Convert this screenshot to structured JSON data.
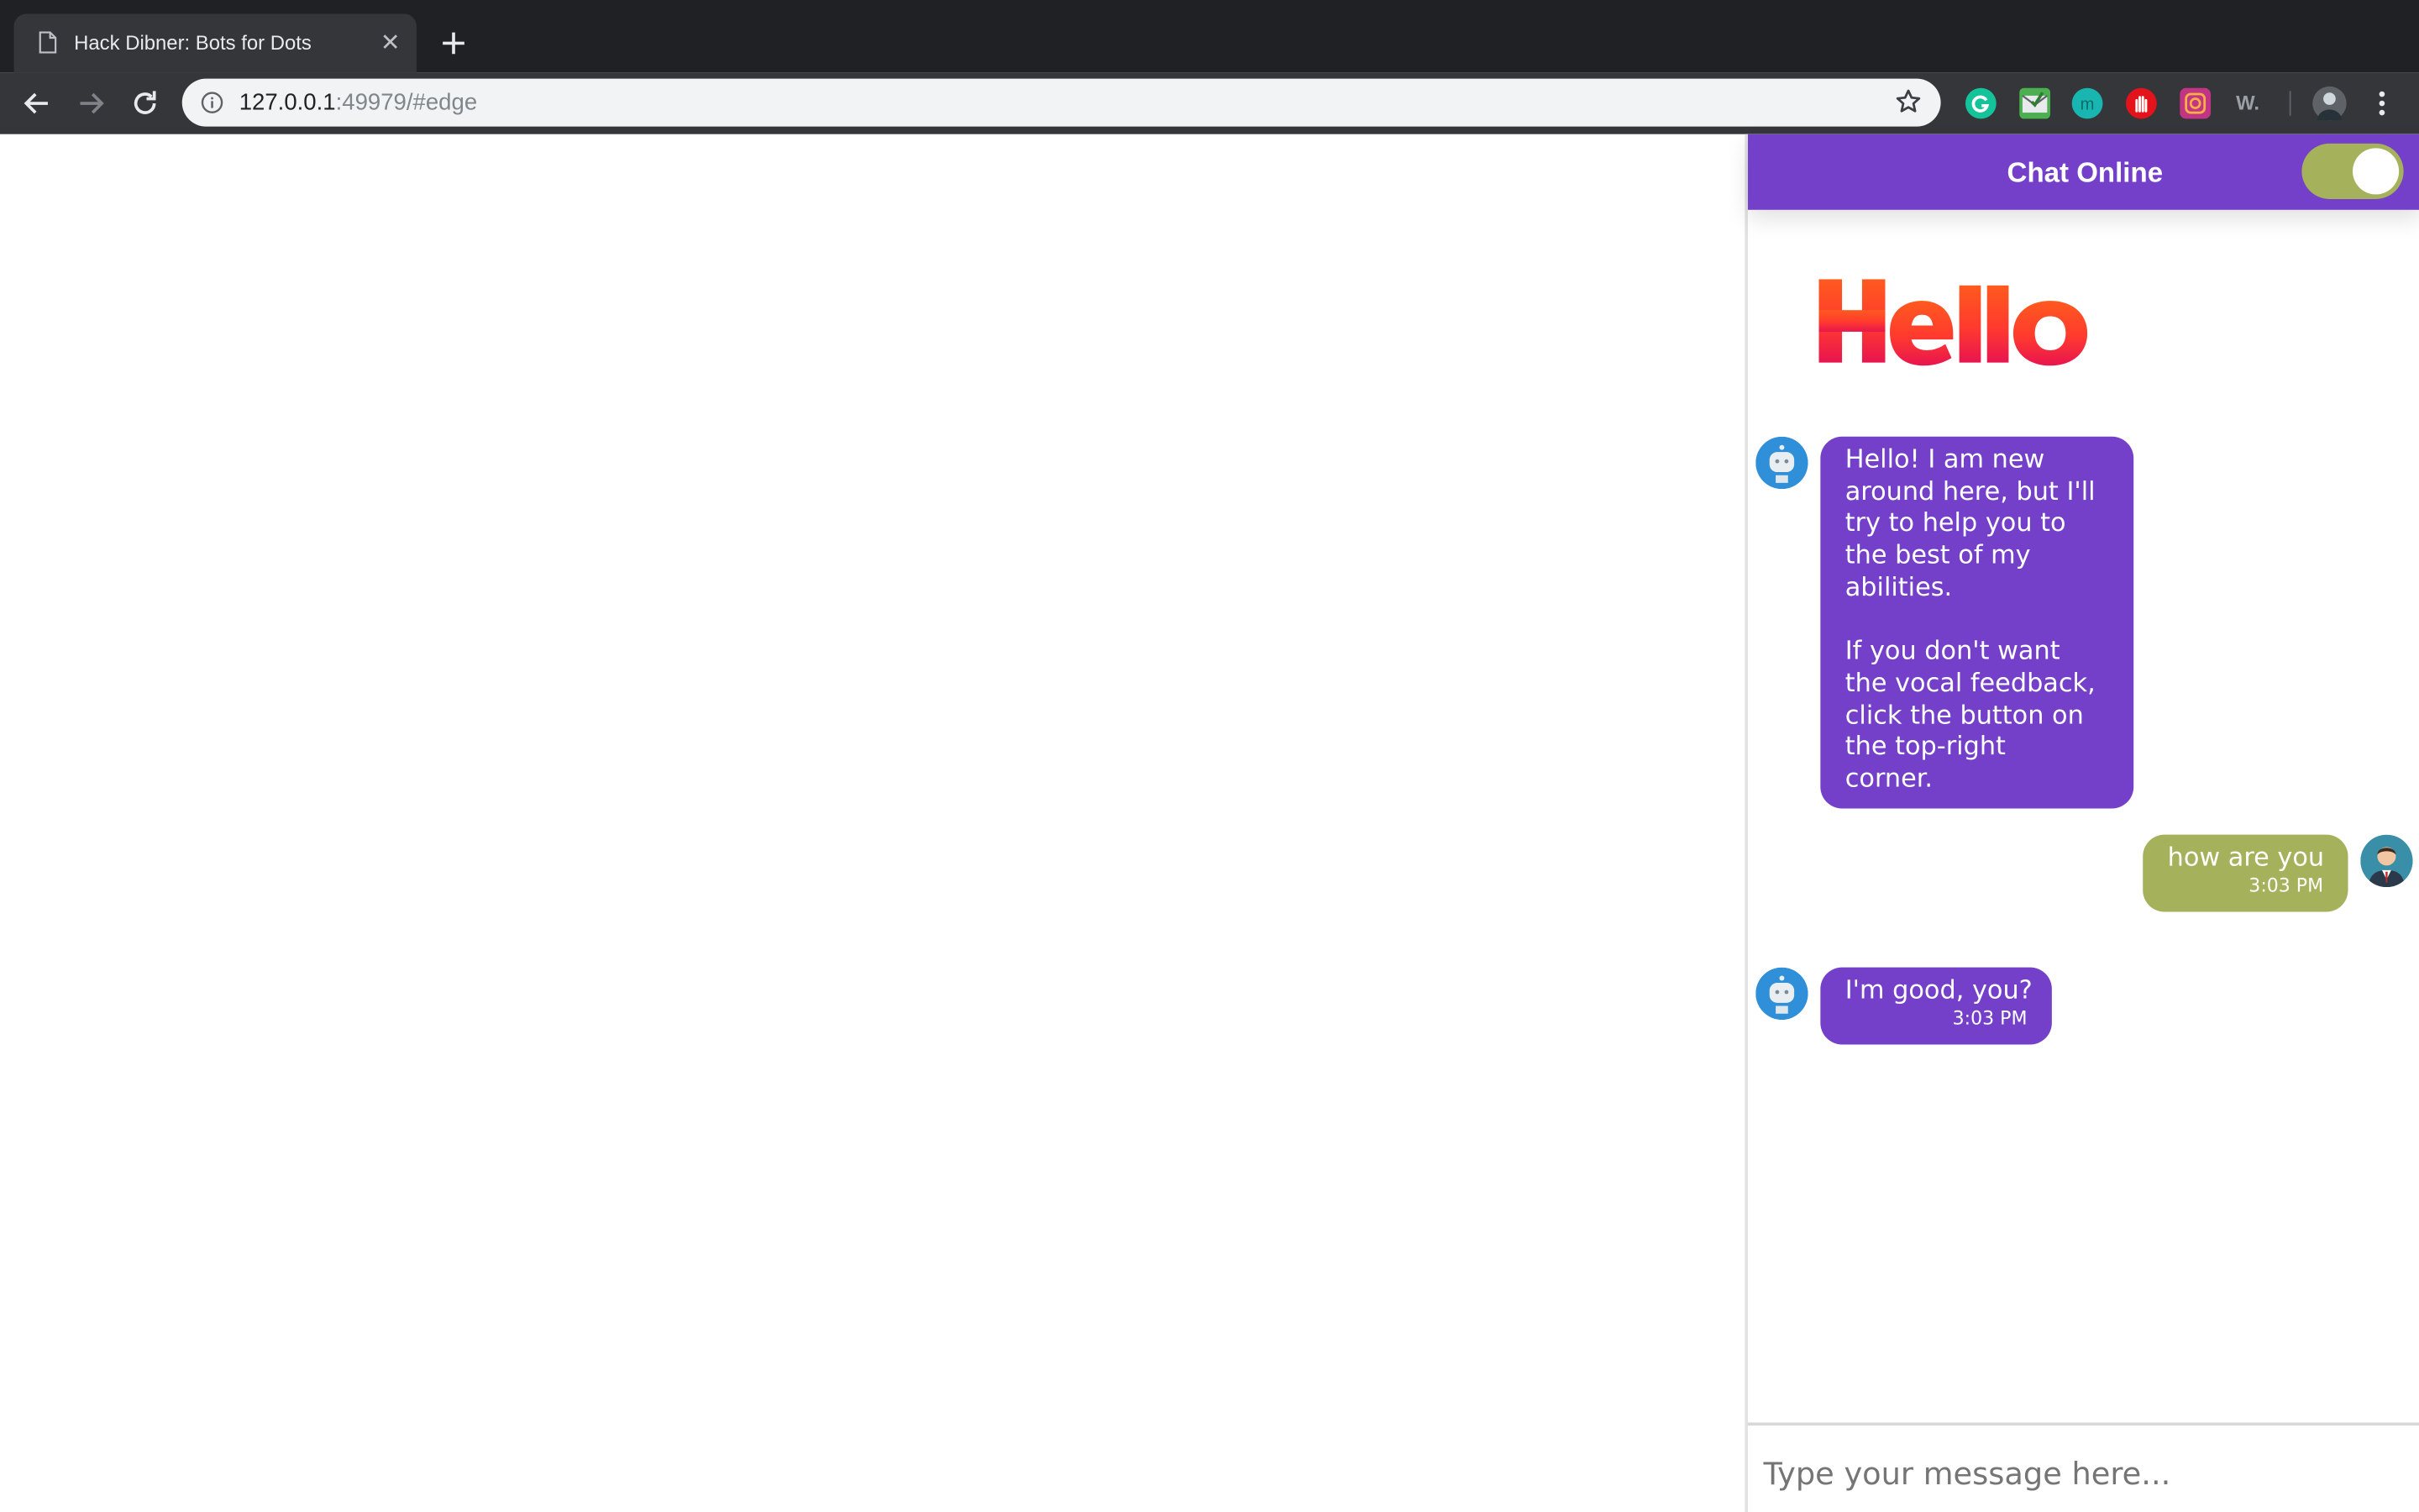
{
  "browser": {
    "tab_title": "Hack Dibner: Bots for Dots",
    "url_host": "127.0.0.1",
    "url_rest": ":49979/#edge",
    "extensions": [
      "grammarly-icon",
      "mail-extension-icon",
      "m-extension-icon",
      "hand-extension-icon",
      "instagram-extension-icon",
      "w-extension-icon"
    ]
  },
  "chat": {
    "title": "Chat Online",
    "toggle_on": true,
    "logo_text": "Hello",
    "messages": [
      {
        "sender": "bot",
        "lines": [
          "Hello! I am new",
          "around here, but I'll",
          "try to help you to",
          "the best of my",
          "abilities.",
          "",
          "If you don't want",
          "the vocal feedback,",
          "click the button on",
          "the top-right",
          "corner."
        ]
      },
      {
        "sender": "user",
        "text": "how are you",
        "time": "3:03 PM"
      },
      {
        "sender": "bot",
        "text": "I'm good, you?",
        "time": "3:03 PM"
      }
    ],
    "input_placeholder": "Type your message here..."
  },
  "colors": {
    "accent_purple": "#7440c9",
    "user_green": "#a5b25b",
    "chrome_dark": "#202124"
  }
}
